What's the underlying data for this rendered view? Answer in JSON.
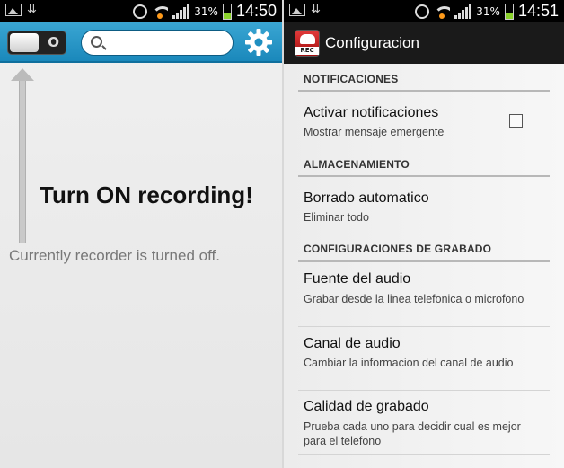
{
  "left_screen": {
    "status_bar": {
      "battery_percent": "31%",
      "time": "14:50"
    },
    "toggle": {
      "state_label": "O"
    },
    "search": {
      "placeholder": ""
    },
    "headline": "Turn ON recording!",
    "status_text": "Currently recorder is turned off."
  },
  "right_screen": {
    "status_bar": {
      "battery_percent": "31%",
      "time": "14:51"
    },
    "app_icon_text": "REC",
    "title": "Configuracion",
    "sections": [
      {
        "header": "NOTIFICACIONES"
      },
      {
        "header": "ALMACENAMIENTO"
      },
      {
        "header": "CONFIGURACIONES DE GRABADO"
      }
    ],
    "items": [
      {
        "title": "Activar notificaciones",
        "subtitle": "Mostrar mensaje emergente"
      },
      {
        "title": "Borrado automatico",
        "subtitle": "Eliminar todo"
      },
      {
        "title": "Fuente del audio",
        "subtitle": "Grabar desde la linea telefonica o microfono"
      },
      {
        "title": "Canal de audio",
        "subtitle": "Cambiar la informacion del canal de audio"
      },
      {
        "title": "Calidad de grabado",
        "subtitle": "Prueba cada uno para decidir cual es mejor para el telefono"
      }
    ]
  },
  "colors": {
    "action_bar_blue": "#2a97c8",
    "battery_green": "#8bd22b",
    "wifi_orange": "#ff9a1a",
    "rec_red": "#c22020"
  }
}
